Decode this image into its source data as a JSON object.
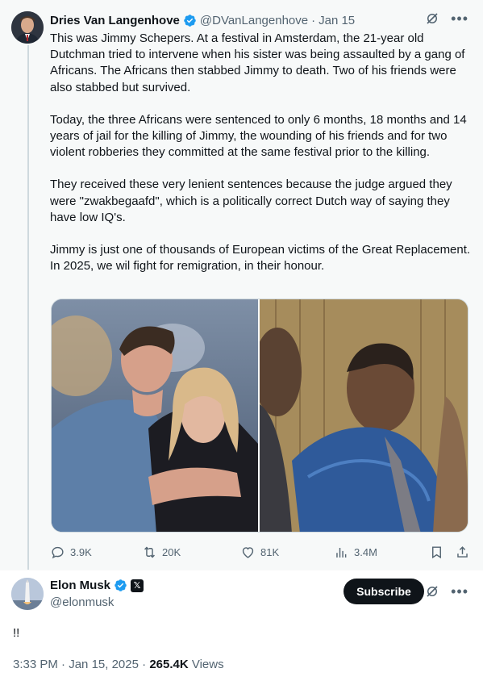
{
  "quoted_tweet": {
    "author_name": "Dries Van Langenhove",
    "author_handle": "@DVanLangenhove",
    "separator": "·",
    "date": "Jan 15",
    "body": [
      "This was Jimmy Schepers. At a festival in Amsterdam, the 21-year old Dutchman tried to intervene when his sister was being assaulted by a gang of Africans. The Africans then stabbed Jimmy to death. Two of his friends were also stabbed but survived.",
      "Today, the three Africans were sentenced to only 6 months, 18 months and 14 years of jail for the killing of Jimmy, the wounding of his friends and for two violent robberies they committed at the same festival prior to the killing.",
      "They received these very lenient sentences because the judge argued they were \"zwakbegaafd\", which is a politically correct Dutch way of saying they have low IQ's.",
      "Jimmy is just one of thousands of European victims of the Great Replacement. In 2025, we wil fight for remigration, in their honour."
    ],
    "metrics": {
      "replies": "3.9K",
      "reposts": "20K",
      "likes": "81K",
      "views": "3.4M"
    },
    "icons": [
      "verified-badge-icon",
      "grok-icon",
      "more-icon",
      "reply-icon",
      "repost-icon",
      "like-icon",
      "views-icon",
      "bookmark-icon",
      "share-icon"
    ]
  },
  "reply_tweet": {
    "author_name": "Elon Musk",
    "author_handle": "@elonmusk",
    "subscribe_label": "Subscribe",
    "text": "!!",
    "time": "3:33 PM",
    "date": "Jan 15, 2025",
    "sep1": " · ",
    "sep2": " · ",
    "views_count": "265.4K",
    "views_label": " Views",
    "affiliate_badge": "𝕏"
  },
  "colors": {
    "accent_blue": "#1d9bf0",
    "text_primary": "#0f1419",
    "text_secondary": "#536471",
    "quoted_bg": "#f7f9f9",
    "border": "#cfd9de"
  }
}
